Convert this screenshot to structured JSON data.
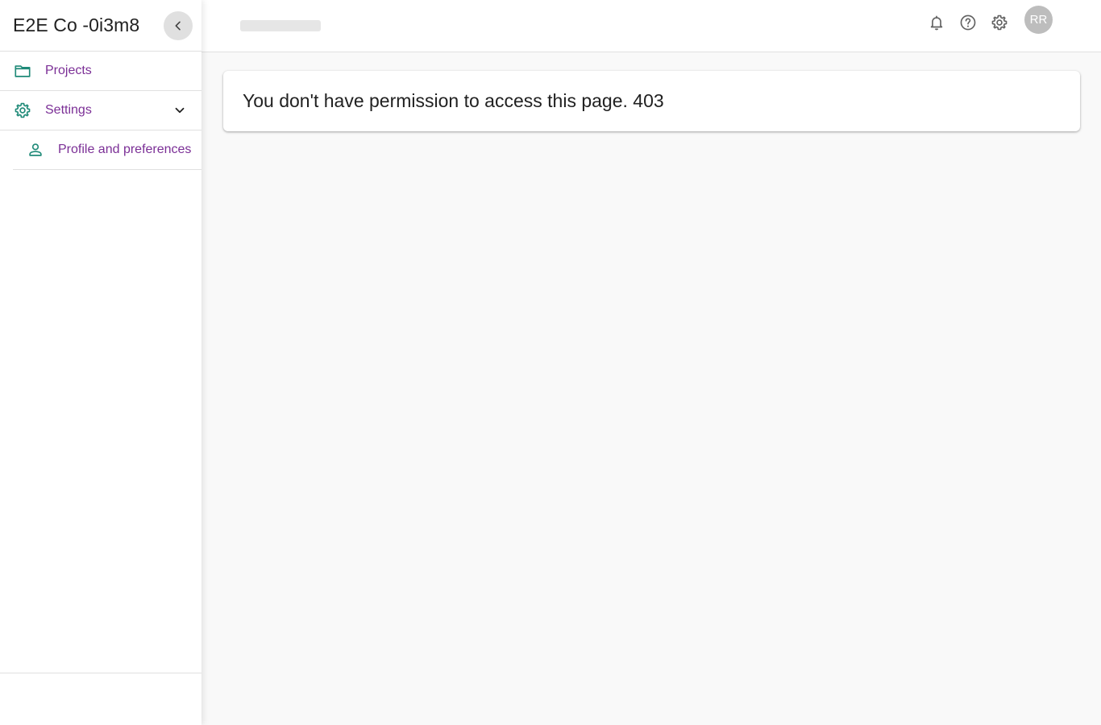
{
  "sidebar": {
    "org_name": "E2E Co -0i3m8",
    "items": [
      {
        "label": "Projects",
        "icon": "folder-icon"
      },
      {
        "label": "Settings",
        "icon": "gear-icon"
      },
      {
        "label": "Profile and preferences",
        "icon": "person-icon"
      }
    ]
  },
  "topbar": {
    "avatar_initials": "RR",
    "icons": [
      "bell-icon",
      "help-icon",
      "gear-icon"
    ]
  },
  "main": {
    "message": "You don't have permission to access this page. 403"
  },
  "colors": {
    "accent_text": "#7b2f96",
    "icon_teal": "#1f8a78",
    "icon_gray": "#616161"
  }
}
